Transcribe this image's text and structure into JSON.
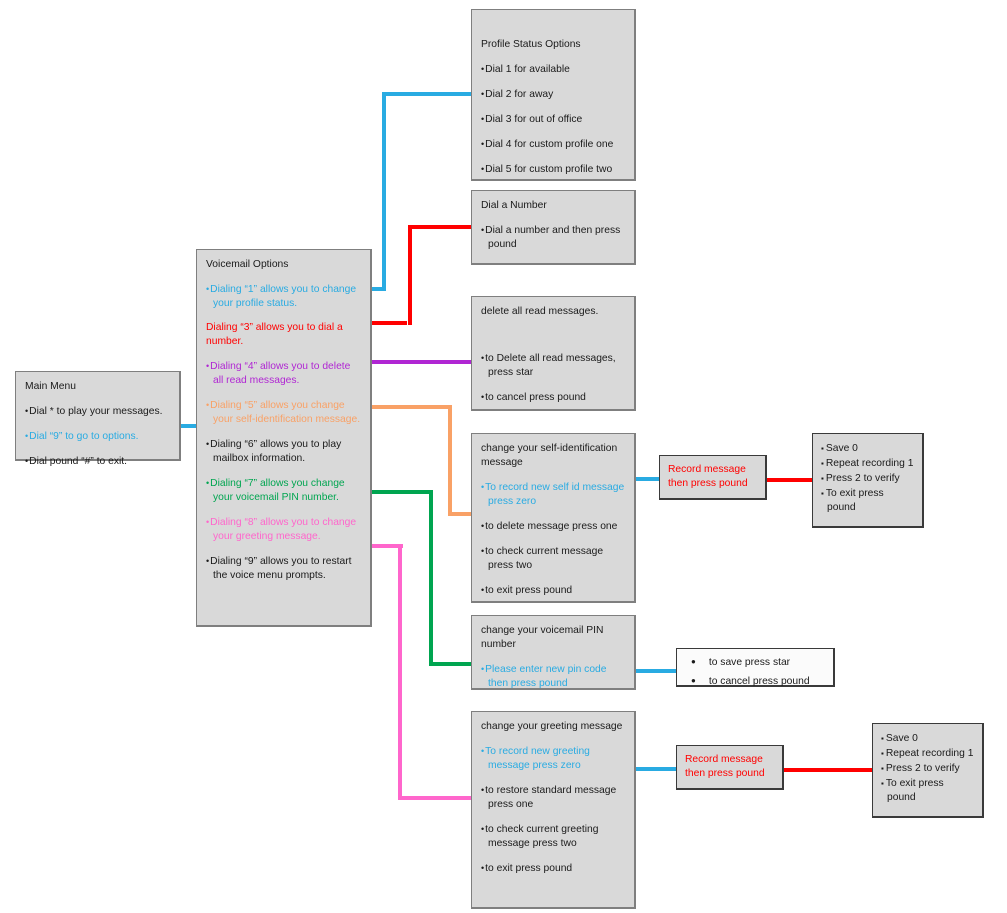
{
  "diagram": {
    "title": "Voicemail Menu Flowchart",
    "colors": {
      "cyan": "#29ABE2",
      "red": "#FF0000",
      "purple": "#B026D3",
      "orange": "#F9A166",
      "green": "#00A550",
      "pink": "#FF66CC",
      "box_fill": "#D9D9D9",
      "box_border": "#7F7F7F"
    }
  },
  "main_menu": {
    "title": "Main Menu",
    "items": [
      "Dial * to play your messages.",
      "Dial “9” to go to options.",
      "Dial pound “#” to exit."
    ]
  },
  "voicemail_options": {
    "title": "Voicemail Options",
    "items": [
      "Dialing “1” allows you to change your profile status.",
      "Dialing “3” allows you to dial a number.",
      "Dialing “4” allows you to delete all read messages.",
      "Dialing “5” allows you change your self-identification message.",
      "Dialing “6” allows you to play mailbox information.",
      "Dialing “7” allows you change your voicemail PIN number.",
      "Dialing “8” allows you to change your greeting message.",
      "Dialing “9” allows you to restart the voice menu prompts."
    ]
  },
  "profile_status": {
    "title": "Profile Status Options",
    "items": [
      "Dial 1 for available",
      "Dial 2 for away",
      "Dial 3 for out of office",
      "Dial 4 for custom profile one",
      "Dial 5 for custom profile two"
    ]
  },
  "dial_a_number": {
    "title": "Dial a Number",
    "items": [
      "Dial a number and then press pound"
    ]
  },
  "delete_read": {
    "title": "delete all read messages.",
    "items": [
      "to Delete all read messages, press star",
      "to cancel press pound"
    ]
  },
  "self_id": {
    "title": "change your self-identification message",
    "items": [
      "To record new self id message press zero",
      "to delete message press one",
      "to check current message press two",
      "to exit press pound"
    ]
  },
  "pin": {
    "title": "change your voicemail PIN number",
    "items": [
      "Please enter new pin code then press pound"
    ]
  },
  "pin_confirm": {
    "items": [
      "to save press star",
      "to cancel press pound"
    ]
  },
  "greeting": {
    "title": "change your greeting message",
    "items": [
      "To record new greeting message press zero",
      "to restore standard message press one",
      "to check current greeting message press two",
      "to exit press pound"
    ]
  },
  "record_selfid": {
    "text": "Record message then press pound"
  },
  "record_greeting": {
    "text": "Record message then press pound"
  },
  "save_selfid": {
    "items": [
      "Save 0",
      "Repeat recording 1",
      "Press 2 to verify",
      "To exit press pound"
    ]
  },
  "save_greeting": {
    "items": [
      "Save 0",
      "Repeat recording 1",
      "Press 2 to verify",
      "To exit press pound"
    ]
  },
  "chart_data": {
    "type": "table",
    "title": "Voicemail Menu Flowchart",
    "nodes": [
      "Main Menu",
      "Voicemail Options",
      "Profile Status Options",
      "Dial a Number",
      "delete all read messages.",
      "change your self-identification message",
      "Record message then press pound",
      "Save 0 / Repeat recording 1 / Press 2 to verify / To exit press pound",
      "change your voicemail PIN number",
      "to save press star / to cancel press pound",
      "change your greeting message"
    ],
    "edges": [
      {
        "from": "Main Menu",
        "to": "Voicemail Options",
        "color": "#29ABE2"
      },
      {
        "from": "Voicemail Options",
        "to": "Profile Status Options",
        "color": "#29ABE2"
      },
      {
        "from": "Voicemail Options",
        "to": "Dial a Number",
        "color": "#FF0000"
      },
      {
        "from": "Voicemail Options",
        "to": "delete all read messages.",
        "color": "#B026D3"
      },
      {
        "from": "Voicemail Options",
        "to": "change your self-identification message",
        "color": "#F9A166"
      },
      {
        "from": "Voicemail Options",
        "to": "change your voicemail PIN number",
        "color": "#00A550"
      },
      {
        "from": "Voicemail Options",
        "to": "change your greeting message",
        "color": "#FF66CC"
      },
      {
        "from": "change your self-identification message",
        "to": "Record message then press pound",
        "color": "#29ABE2"
      },
      {
        "from": "Record message then press pound",
        "to": "Save 0 list",
        "color": "#FF0000"
      },
      {
        "from": "change your voicemail PIN number",
        "to": "to save press star list",
        "color": "#29ABE2"
      },
      {
        "from": "change your greeting message",
        "to": "Record message then press pound",
        "color": "#29ABE2"
      }
    ]
  }
}
